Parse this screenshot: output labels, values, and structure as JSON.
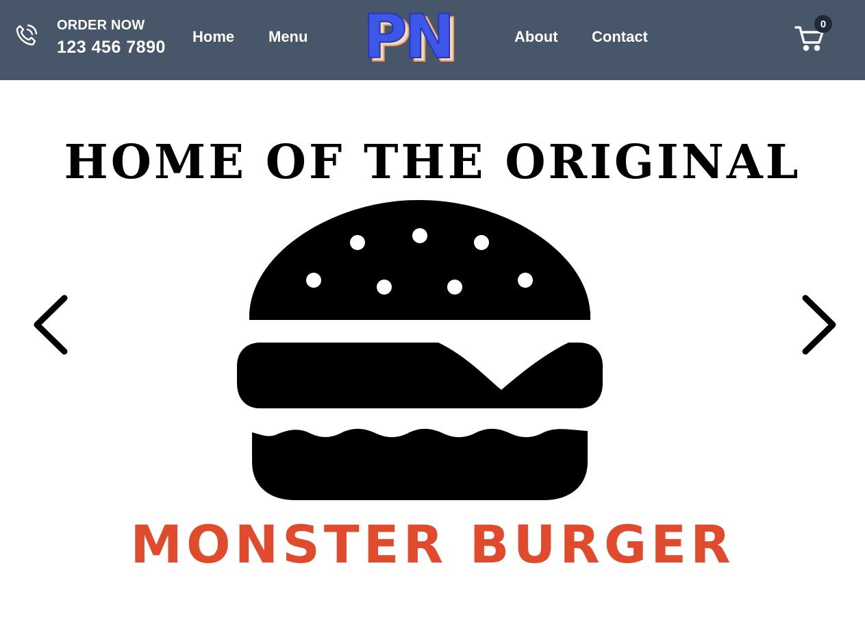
{
  "header": {
    "order": {
      "label": "ORDER NOW",
      "phone": "123 456 7890",
      "icon": "phone-icon"
    },
    "nav_left": [
      {
        "label": "Home"
      },
      {
        "label": "Menu"
      }
    ],
    "logo_text": "PN",
    "nav_right": [
      {
        "label": "About"
      },
      {
        "label": "Contact"
      }
    ],
    "cart": {
      "icon": "cart-icon",
      "count": "0"
    }
  },
  "slider": {
    "headline": "HOME OF THE ORIGINAL",
    "brand": "MONSTER BURGER",
    "prev_icon": "chevron-left-icon",
    "next_icon": "chevron-right-icon"
  },
  "colors": {
    "header_bg": "#48566a",
    "logo_blue": "#3d57e8",
    "logo_cream": "#f7d9b5",
    "brand_red": "#e04a2d",
    "badge_bg": "#1f2937"
  }
}
